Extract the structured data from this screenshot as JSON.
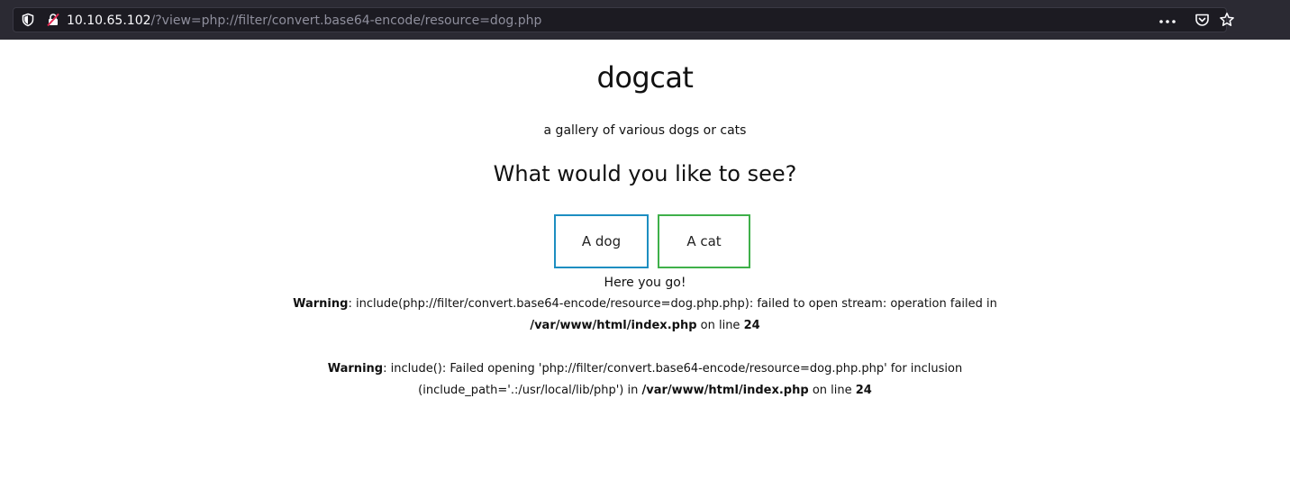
{
  "browser": {
    "url_host": "10.10.65.102",
    "url_path": "/?view=php://filter/convert.base64-encode/resource=dog.php"
  },
  "page": {
    "title": "dogcat",
    "tagline": "a gallery of various dogs or cats",
    "question": "What would you like to see?",
    "buttons": {
      "dog_label": "A dog",
      "cat_label": "A cat"
    },
    "result_text": "Here you go!",
    "warning1": {
      "label": "Warning",
      "line1_rest": ": include(php://filter/convert.base64-encode/resource=dog.php.php): failed to open stream: operation failed in",
      "file": "/var/www/html/index.php",
      "on_line_text": " on line ",
      "line_number": "24"
    },
    "warning2": {
      "label": "Warning",
      "line1_rest": ": include(): Failed opening 'php://filter/convert.base64-encode/resource=dog.php.php' for inclusion",
      "line2_prefix": "(include_path='.:/usr/local/lib/php') in ",
      "file": "/var/www/html/index.php",
      "on_line_text": " on line ",
      "line_number": "24"
    }
  },
  "icons": {
    "shield": "shield-icon",
    "lock": "insecure-lock-icon",
    "menu": "meatball-menu-icon",
    "pocket": "pocket-icon",
    "bookmark": "star-icon"
  },
  "colors": {
    "dog_button_border": "#1d8ec1",
    "cat_button_border": "#3fb04a",
    "toolbar_bg": "#2b2a33",
    "urlbar_bg": "#1c1b22"
  }
}
